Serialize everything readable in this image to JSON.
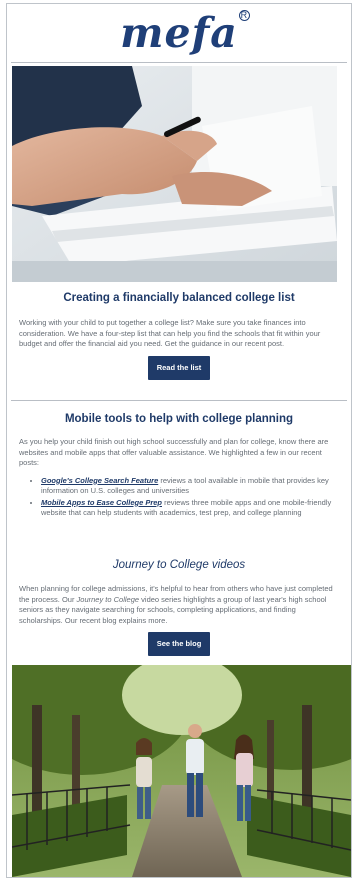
{
  "logo": {
    "text": "mefa",
    "mark": "R"
  },
  "section1": {
    "title": "Creating a financially balanced college list",
    "body": "Working with your child to put together a college list? Make sure you take finances into consideration. We have a four-step list that can help you find the schools that fit within your budget and offer the financial aid you need. Get the guidance in our recent post.",
    "button": "Read the list"
  },
  "section2": {
    "title": "Mobile tools to help with college planning",
    "intro": "As you help your child finish out high school successfully and plan for college, know there are websites and mobile apps that offer valuable assistance. We highlighted a few in our recent posts:",
    "items": [
      {
        "link": "Google's College Search Feature",
        "text": " reviews a tool available in mobile that provides key information on U.S. colleges and universities"
      },
      {
        "link": "Mobile Apps to Ease College Prep",
        "text": " reviews three mobile apps and one mobile-friendly website that can help students with academics, test prep, and college planning"
      }
    ]
  },
  "section3": {
    "title": "Journey to College videos",
    "body_before": "When planning for college admissions, it's helpful to hear from others who have just completed the process. Our ",
    "body_em": "Journey to College",
    "body_after": " video series highlights a group of last year's high school seniors as they navigate searching for schools, completing applications, and finding scholarships. Our recent blog explains more.",
    "button": "See the blog"
  },
  "colors": {
    "brand": "#1f3a68",
    "text": "#666d75",
    "rule": "#b9bec5"
  }
}
